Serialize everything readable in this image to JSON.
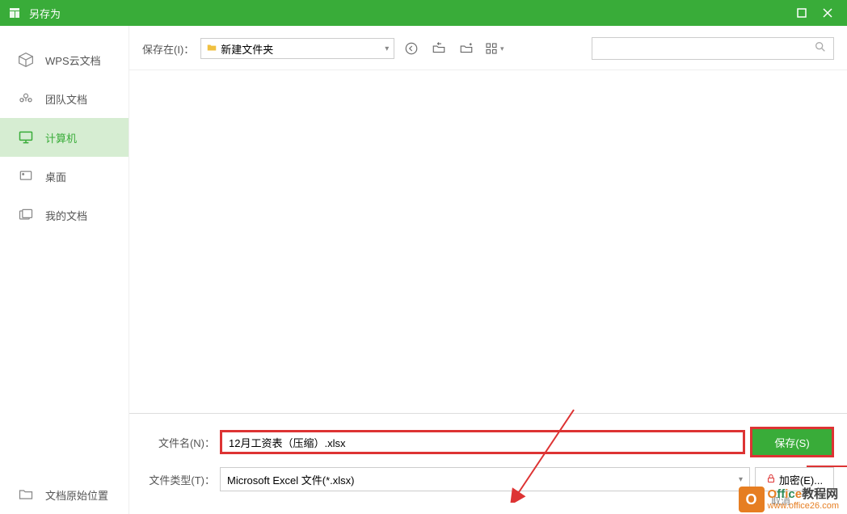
{
  "window": {
    "title": "另存为"
  },
  "sidebar": {
    "items": [
      {
        "label": "WPS云文档"
      },
      {
        "label": "团队文档"
      },
      {
        "label": "计算机"
      },
      {
        "label": "桌面"
      },
      {
        "label": "我的文档"
      },
      {
        "label": "文档原始位置"
      }
    ]
  },
  "toolbar": {
    "save_in_label": "保存在(I)：",
    "folder_name": "新建文件夹",
    "search_placeholder": ""
  },
  "form": {
    "filename_label": "文件名(N)：",
    "filename_value": "12月工资表（压缩）.xlsx",
    "filetype_label": "文件类型(T)：",
    "filetype_value": "Microsoft Excel 文件(*.xlsx)",
    "save_label": "保存(S)",
    "encrypt_label": "加密(E)...",
    "cancel_label": "取消"
  },
  "watermark": {
    "title_office": "Office",
    "title_rest": "教程网",
    "url": "www.office26.com"
  }
}
